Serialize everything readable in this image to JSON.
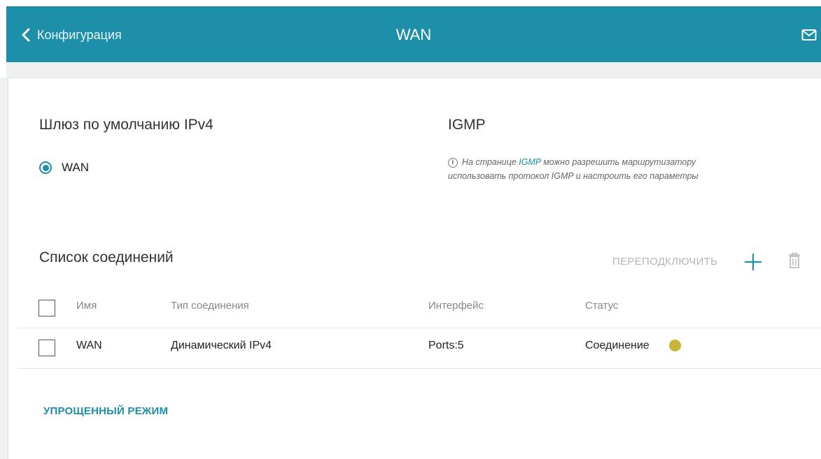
{
  "header": {
    "back_label": "Конфигурация",
    "title": "WAN",
    "background_color": "#1d8fa8"
  },
  "gateway": {
    "heading": "Шлюз по умолчанию IPv4",
    "option_label": "WAN",
    "selected": true
  },
  "igmp": {
    "heading": "IGMP",
    "info_icon": "info-icon",
    "info_prefix": "На странице ",
    "info_link": "IGMP",
    "info_suffix": " можно разрешить маршрутизатору",
    "info_line2": "использовать протокол IGMP и настроить его параметры"
  },
  "connections": {
    "heading": "Список соединений",
    "reconnect_label": "ПЕРЕПОДКЛЮЧИТЬ",
    "columns": {
      "name": "Имя",
      "type": "Тип соединения",
      "interface": "Интерфейс",
      "status": "Статус"
    },
    "rows": [
      {
        "name": "WAN",
        "type": "Динамический IPv4",
        "interface": "Ports:5",
        "status": "Соединение",
        "status_color": "#c9b43a"
      }
    ]
  },
  "footer": {
    "simple_mode_label": "УПРОЩЕННЫЙ РЕЖИМ"
  }
}
